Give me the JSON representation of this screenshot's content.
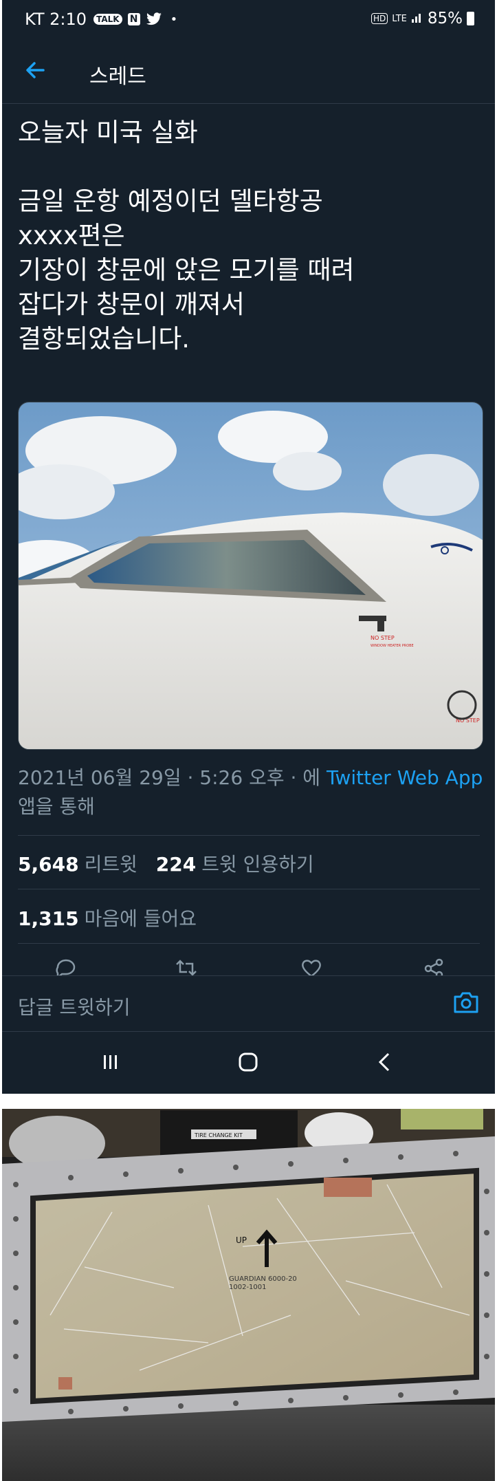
{
  "status_bar": {
    "carrier_time": "KT 2:10",
    "talk_badge": "TALK",
    "n_badge": "N",
    "hd_badge": "HD",
    "lte_badge": "LTE",
    "battery": "85%"
  },
  "header": {
    "title": "스레드"
  },
  "tweet": {
    "text": "오늘자 미국 실화\n\n금일 운항 예정이던 델타항공\nxxxx편은\n기장이 창문에 앉은 모기를 때려\n잡다가 창문이 깨져서\n결항되었습니다.",
    "timestamp": "2021년 06월 29일 · 5:26 오후 · 에 ",
    "source_app": "Twitter Web App",
    "source_suffix": "앱을 통해",
    "retweets_count": "5,648",
    "retweets_label": "리트윗",
    "quotes_count": "224",
    "quotes_label": "트윗 인용하기",
    "likes_count": "1,315",
    "likes_label": "마음에 들어요"
  },
  "media": {
    "cockpit_placard": "NO STEP",
    "cockpit_placard_sub": "WINDOW HEATER PROBE"
  },
  "reply": {
    "placeholder": "답글 트윗하기"
  },
  "colors": {
    "background": "#15202b",
    "link": "#1da1f2",
    "muted": "#8899a6",
    "divider": "#2f3b48"
  },
  "icons": [
    "back-arrow-icon",
    "reply-icon",
    "retweet-icon",
    "like-icon",
    "share-icon",
    "camera-icon",
    "recents-icon",
    "home-icon",
    "back-icon"
  ],
  "photo2": {
    "box_label": "TIRE CHANGE KIT",
    "glass_arrow_label": "UP",
    "glass_stencil": "GUARDIAN 6000-20",
    "glass_stencil2": "1002-1001"
  }
}
